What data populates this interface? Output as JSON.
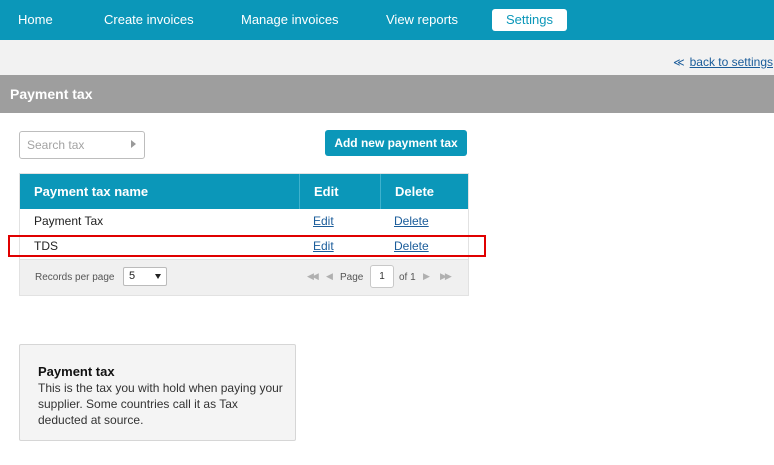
{
  "nav": {
    "items": [
      "Home",
      "Create invoices",
      "Manage invoices",
      "View reports",
      "Settings"
    ],
    "active": "Settings"
  },
  "back_link": "back to settings",
  "page_title": "Payment tax",
  "search": {
    "placeholder": "Search tax"
  },
  "add_button": "Add new payment tax",
  "table": {
    "columns": [
      "Payment tax name",
      "Edit",
      "Delete"
    ],
    "rows": [
      {
        "name": "Payment Tax",
        "edit": "Edit",
        "delete": "Delete"
      },
      {
        "name": "TDS",
        "edit": "Edit",
        "delete": "Delete"
      }
    ],
    "highlighted_row": "TDS"
  },
  "pager": {
    "records_per_page_label": "Records per page",
    "records_per_page_value": "5",
    "page_label": "Page",
    "page_value": "1",
    "of_label": "of 1"
  },
  "info": {
    "title": "Payment tax",
    "text": "This is the tax you with hold when paying your supplier. Some countries call it as Tax deducted at source."
  },
  "colors": {
    "accent": "#0b97b9",
    "title_bar": "#9e9e9e",
    "highlight": "#e00000",
    "link": "#1a5c9a"
  }
}
